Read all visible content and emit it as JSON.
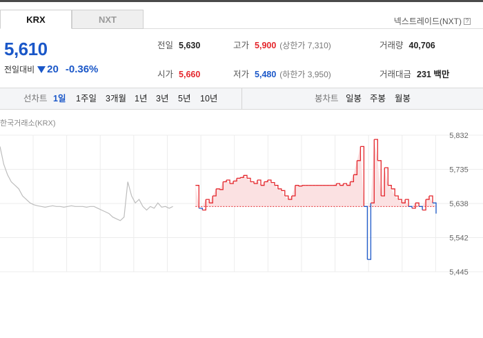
{
  "tabs": [
    {
      "label": "KRX",
      "active": true
    },
    {
      "label": "NXT",
      "active": false
    }
  ],
  "nxt_link": {
    "label": "넥스트레이드(NXT)",
    "help_icon": "?"
  },
  "quote": {
    "price": "5,610",
    "change_label": "전일대비",
    "change_amount": "20",
    "change_percent": "-0.36%",
    "direction": "down"
  },
  "stats": {
    "prev_close": {
      "label": "전일",
      "value": "5,630"
    },
    "high": {
      "label": "고가",
      "value": "5,900",
      "sub": "(상한가 7,310)"
    },
    "volume": {
      "label": "거래량",
      "value": "40,706"
    },
    "open": {
      "label": "시가",
      "value": "5,660"
    },
    "low": {
      "label": "저가",
      "value": "5,480",
      "sub": "(하한가 3,950)"
    },
    "trade_value": {
      "label": "거래대금",
      "value": "231 백만"
    }
  },
  "periods": {
    "line_label": "선차트",
    "line_items": [
      "1일",
      "1주일",
      "3개월",
      "1년",
      "3년",
      "5년",
      "10년"
    ],
    "active": "1일",
    "candle_label": "봉차트",
    "candle_items": [
      "일봉",
      "주봉",
      "월봉"
    ]
  },
  "chart_caption": "한국거래소(KRX)",
  "colors": {
    "up": "#e4252b",
    "down": "#1a57c8",
    "accent": "#1a57c8",
    "pre_market": "#bdbdbd"
  },
  "chart_data": {
    "type": "line",
    "title": "",
    "ylim": [
      5445,
      5832
    ],
    "y_ticks": [
      "5,832",
      "5,735",
      "5,638",
      "5,542",
      "5,445"
    ],
    "baseline": 5630,
    "grid": true,
    "series": [
      {
        "values": [
          5800,
          5750,
          5720,
          5700,
          5690,
          5680,
          5660,
          5650,
          5640,
          5635,
          5632,
          5630,
          5628,
          5630,
          5632,
          5630,
          5630,
          5628,
          5630,
          5632,
          5630,
          5630,
          5630,
          5628,
          5630,
          5630,
          5625,
          5620,
          5615,
          5610,
          5600,
          5595,
          5590,
          5600,
          5700,
          5660,
          5640,
          5650,
          5630,
          5620,
          5630,
          5625,
          5640,
          5628,
          5630,
          5625,
          5630
        ]
      },
      {
        "values": [
          5690,
          5625,
          5620,
          5650,
          5640,
          5660,
          5680,
          5678,
          5700,
          5705,
          5695,
          5702,
          5710,
          5712,
          5718,
          5710,
          5700,
          5695,
          5705,
          5690,
          5700,
          5705,
          5698,
          5690,
          5680,
          5675,
          5660,
          5650,
          5660,
          5690,
          5688,
          5690,
          5690,
          5690,
          5690,
          5690,
          5690,
          5690,
          5690,
          5690,
          5690,
          5695,
          5690,
          5695,
          5690,
          5700,
          5720,
          5760,
          5800,
          5630,
          5480,
          5640,
          5820,
          5760,
          5660,
          5740,
          5690,
          5680,
          5660,
          5650,
          5640,
          5650,
          5630,
          5625,
          5640,
          5630,
          5620,
          5650,
          5660,
          5640,
          5610
        ]
      }
    ]
  }
}
